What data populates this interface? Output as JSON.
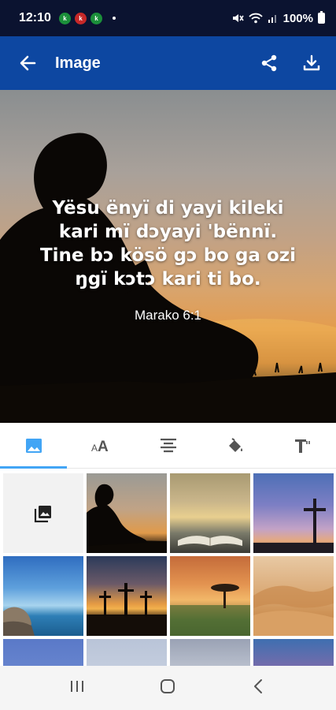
{
  "status_bar": {
    "time": "12:10",
    "battery": "100%",
    "app_icons": [
      "k",
      "k",
      "k"
    ]
  },
  "app_bar": {
    "title": "Image",
    "icons": [
      "arrow-back-icon",
      "share-icon",
      "download-icon"
    ]
  },
  "hero": {
    "verse_lines": [
      "Yësu ënyï di yayi kileki",
      "kari mï dɔyayi 'bënnï.",
      "Tine bɔ kösö gɔ bo ga ozi",
      "ŋgï kɔtɔ kari ti bo."
    ],
    "reference": "Marako 6:1"
  },
  "tabs": [
    {
      "name": "background-image",
      "icon": "image-icon",
      "active": true
    },
    {
      "name": "font",
      "icon": "font-size-icon",
      "active": false
    },
    {
      "name": "alignment",
      "icon": "align-center-icon",
      "active": false
    },
    {
      "name": "color",
      "icon": "paint-bucket-icon",
      "active": false
    },
    {
      "name": "text-style",
      "icon": "text-format-icon",
      "active": false
    }
  ],
  "gallery": {
    "picker_icon": "photo-library-icon",
    "thumbnails": [
      "boy-reading-sunset",
      "open-book-lake",
      "cross-purple-sky",
      "rocks-blue-sea",
      "three-crosses-sunset",
      "acacia-savanna-sunset",
      "desert-dunes",
      "blue-sky-clouds",
      "sky-gradient",
      "mountain-clouds",
      "sea-horizon-pink"
    ]
  },
  "nav_bar": {
    "icons": [
      "recents-icon",
      "home-icon",
      "back-icon"
    ]
  },
  "colors": {
    "status_bar": "#0b1330",
    "app_bar": "#0d47a1",
    "tab_indicator": "#42a5f5"
  }
}
